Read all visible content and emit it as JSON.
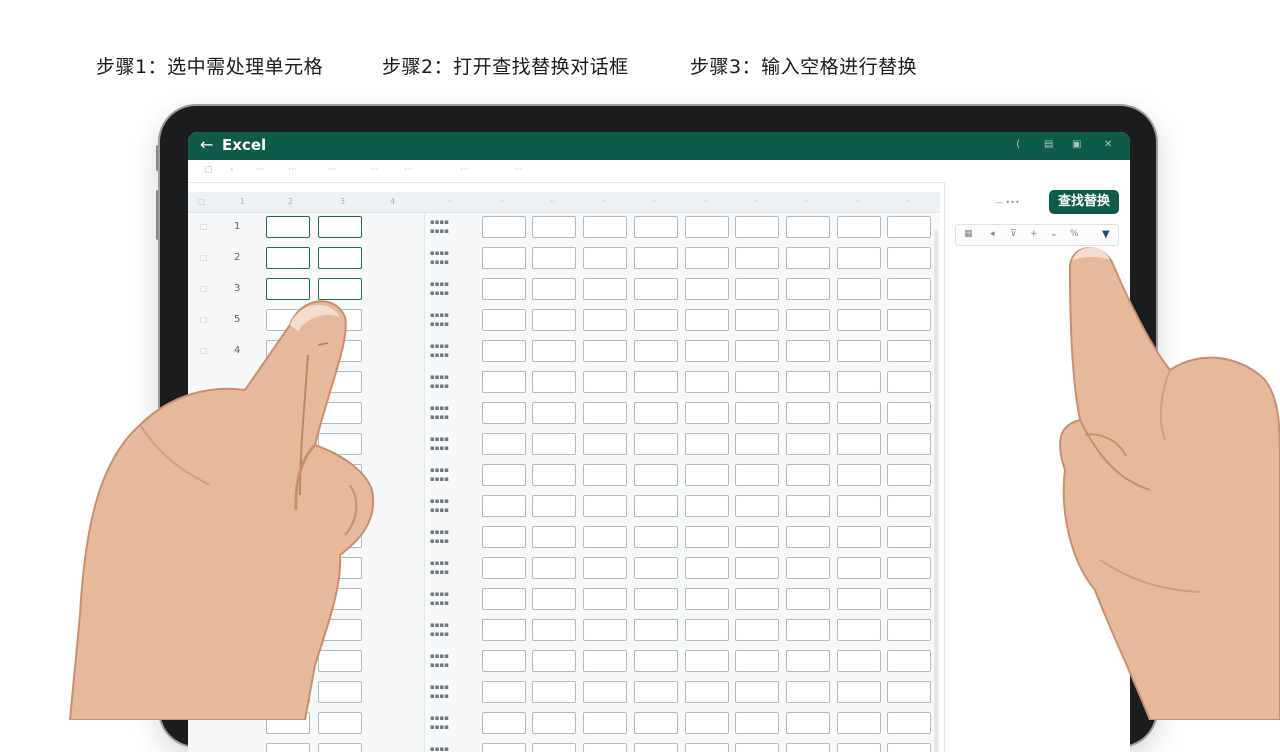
{
  "steps": [
    "步骤1：选中需处理单元格",
    "步骤2：打开查找替换对话框",
    "步骤3：输入空格进行替换"
  ],
  "app": {
    "title": "Excel",
    "back_icon": "arrow-left-icon"
  },
  "panel": {
    "find_replace_label": "查找替换"
  },
  "sheet": {
    "row_numbers": [
      "1",
      "2",
      "3",
      "5",
      "4"
    ],
    "col_headers": [
      "1",
      "2",
      "3",
      "4"
    ]
  },
  "colors": {
    "brand_green": "#0f5b49",
    "selected_cell_border": "#1e6e55",
    "cell_border": "#b3bbc1"
  }
}
